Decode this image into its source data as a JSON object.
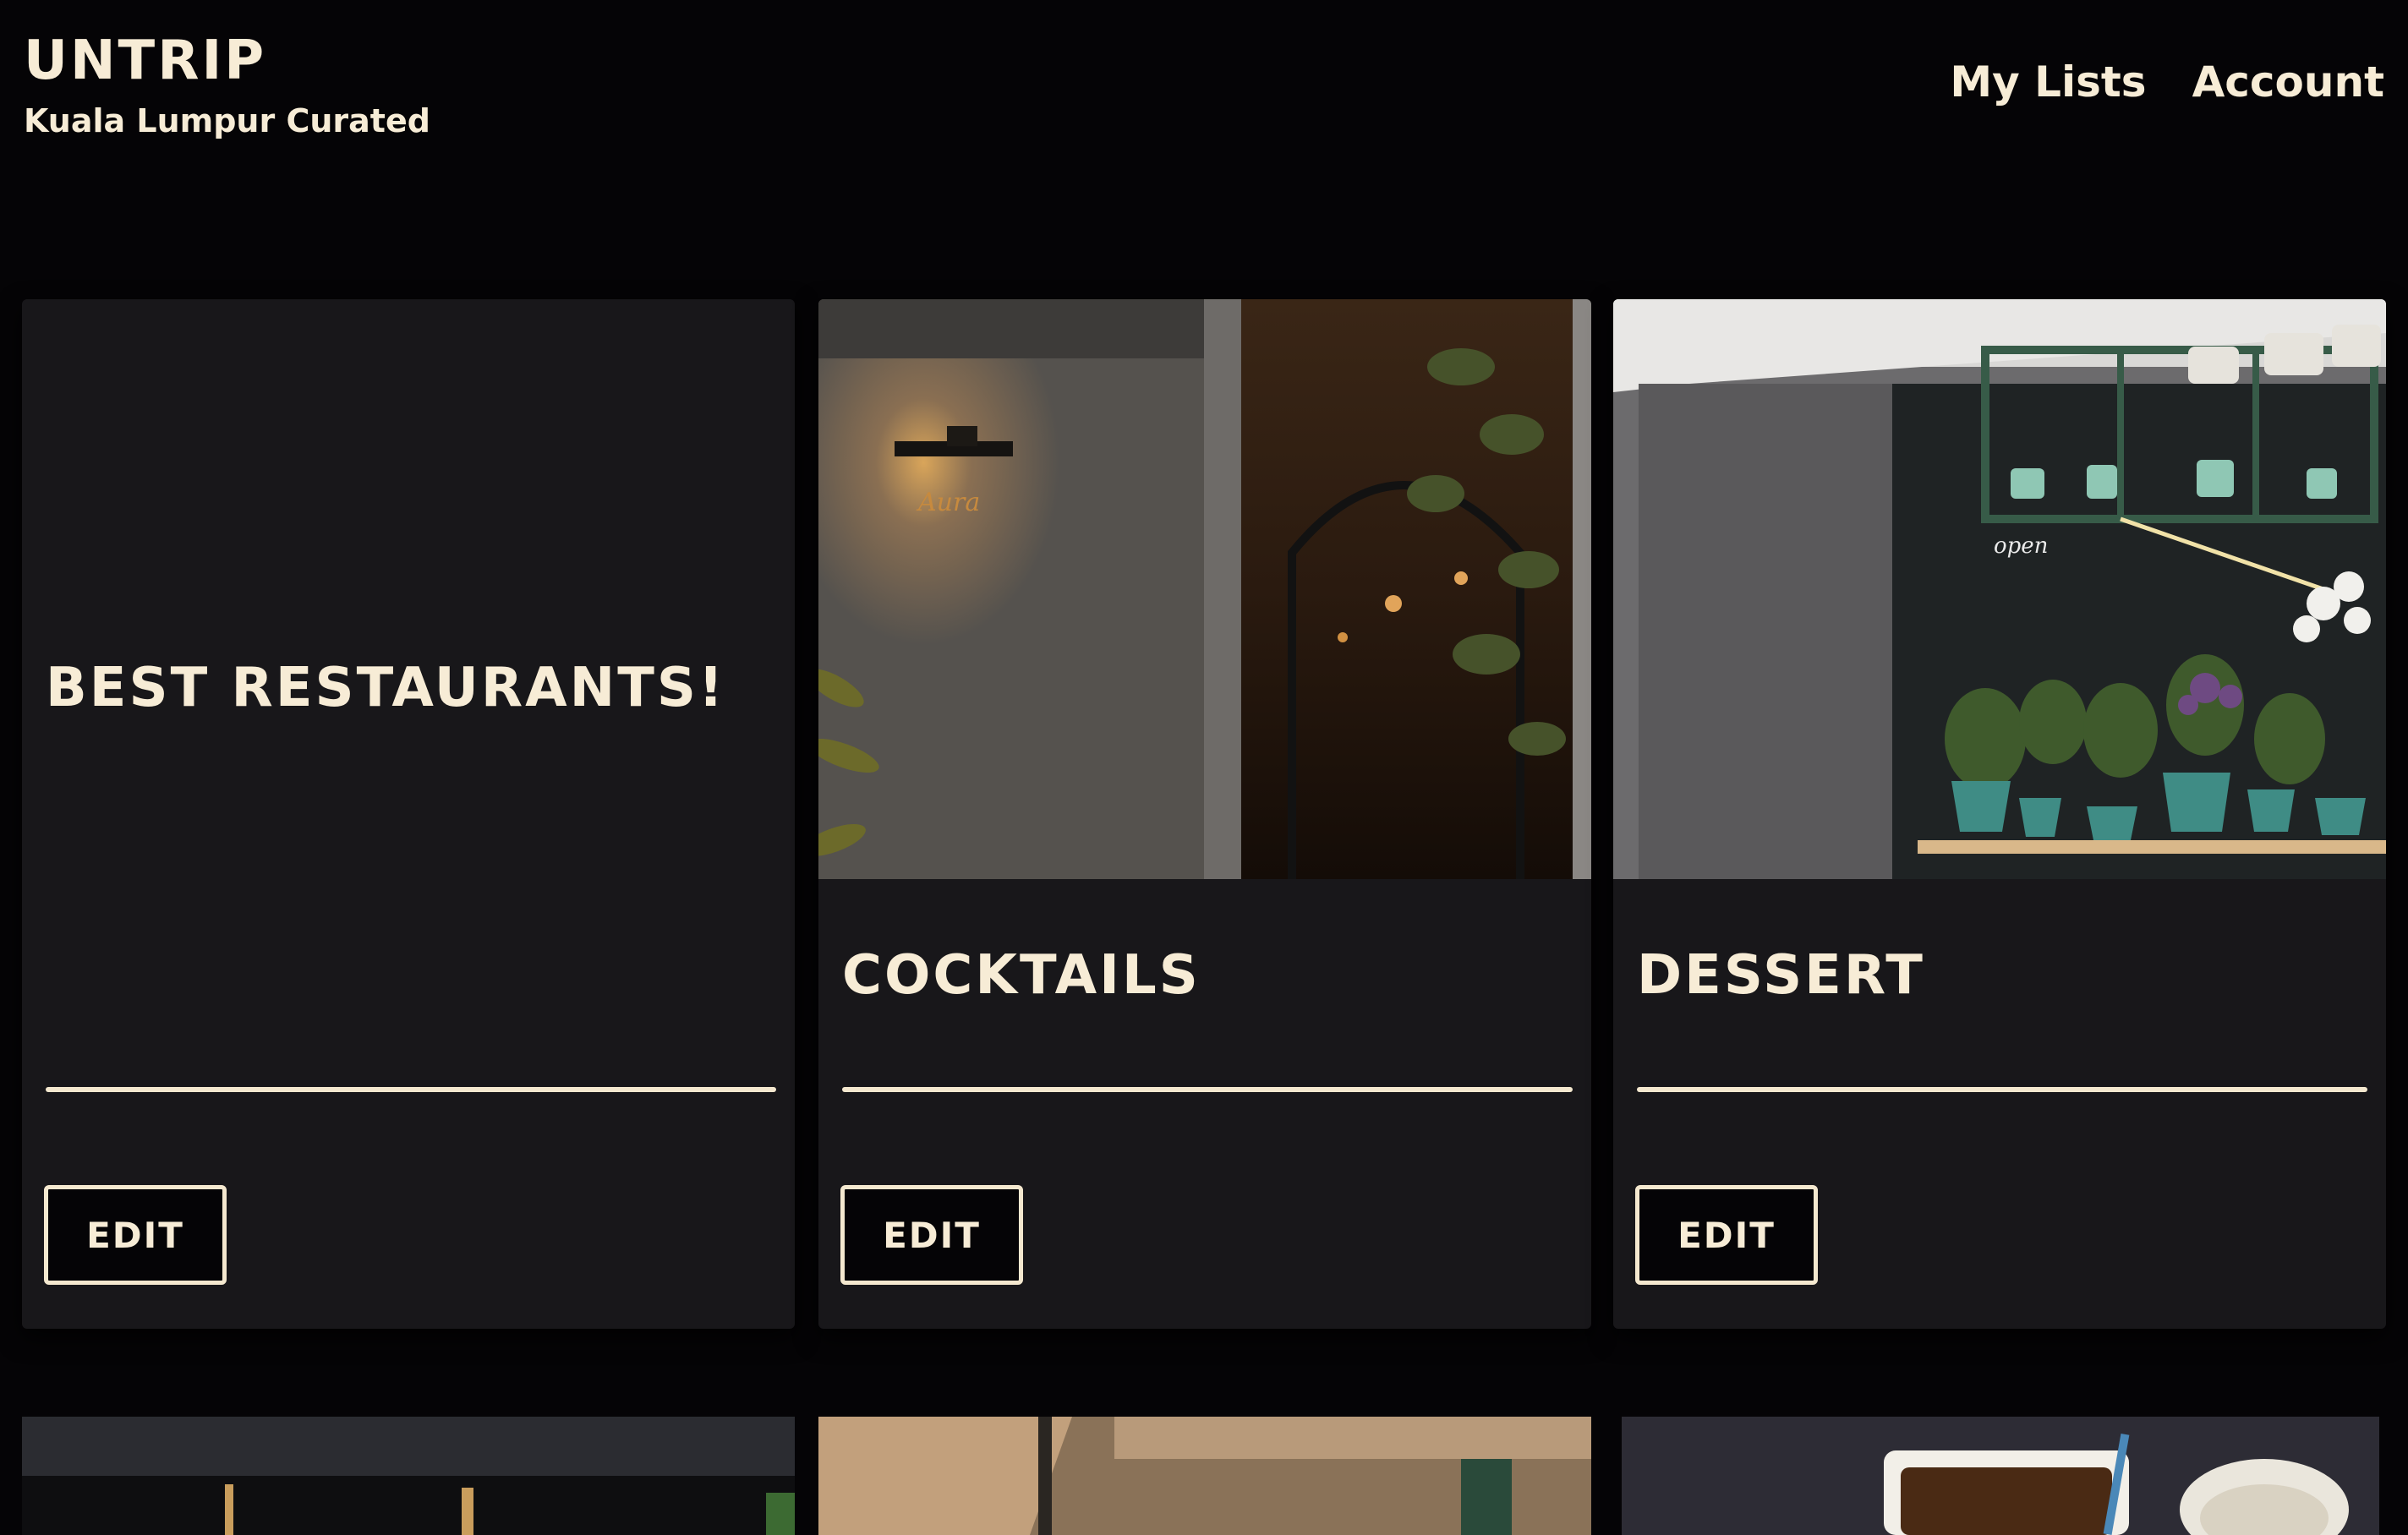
{
  "brand": {
    "title": "UNTRIP",
    "subtitle": "Kuala Lumpur Curated"
  },
  "nav": {
    "my_lists": "My Lists",
    "account": "Account"
  },
  "colors": {
    "accent": "#f4e8cf",
    "card_bg": "#18171a",
    "page_bg": "#050406"
  },
  "lists": [
    {
      "title": "BEST RESTAURANTS!",
      "edit_label": "EDIT",
      "has_image": false
    },
    {
      "title": "COCKTAILS",
      "edit_label": "EDIT",
      "has_image": true
    },
    {
      "title": "DESSERT",
      "edit_label": "EDIT",
      "has_image": true
    }
  ]
}
